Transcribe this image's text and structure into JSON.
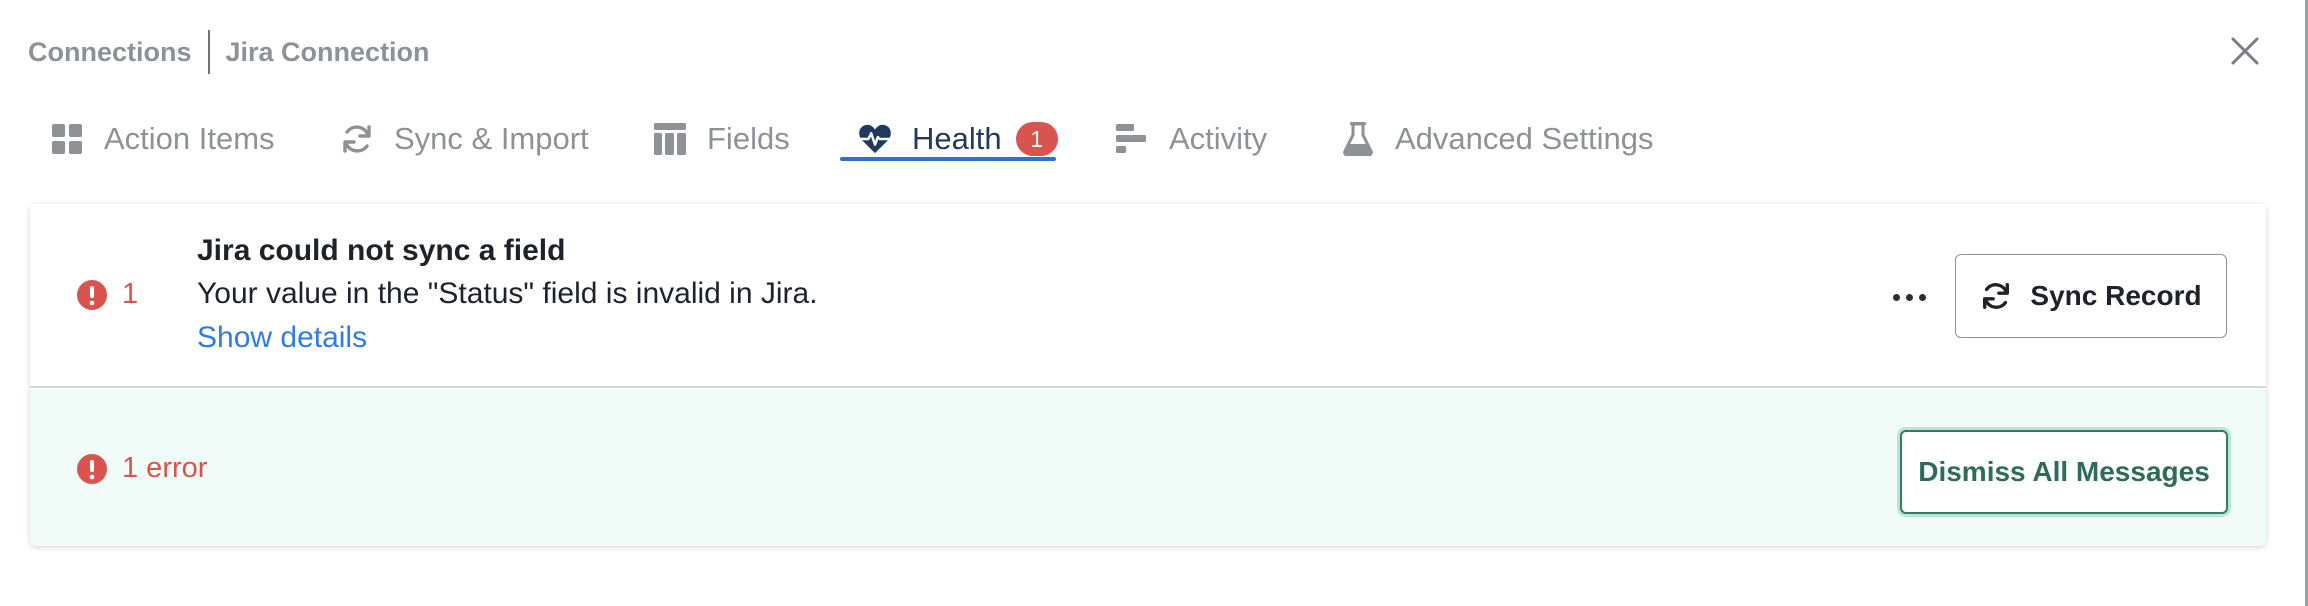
{
  "breadcrumb": {
    "parent": "Connections",
    "current": "Jira Connection"
  },
  "close_icon": "close-icon",
  "tabs": [
    {
      "label": "Action Items",
      "icon": "grid-icon",
      "active": false
    },
    {
      "label": "Sync & Import",
      "icon": "sync-icon",
      "active": false
    },
    {
      "label": "Fields",
      "icon": "table-icon",
      "active": false
    },
    {
      "label": "Health",
      "icon": "heart-pulse-icon",
      "active": true,
      "badge": "1"
    },
    {
      "label": "Activity",
      "icon": "activity-bars-icon",
      "active": false
    },
    {
      "label": "Advanced Settings",
      "icon": "flask-icon",
      "active": false
    }
  ],
  "message": {
    "count": "1",
    "title": "Jira could not sync a field",
    "body": "Your value in the \"Status\" field is invalid in Jira.",
    "link": "Show details",
    "sync_label": "Sync Record"
  },
  "summary": {
    "text": "1 error",
    "dismiss_label": "Dismiss All Messages"
  },
  "colors": {
    "error": "#d9534f",
    "active_tab": "#1f3a5c",
    "underline": "#2f6fd6",
    "link": "#2f7de1",
    "summary_bg": "#f1fbf8",
    "dismiss_border": "#2e7d64"
  }
}
